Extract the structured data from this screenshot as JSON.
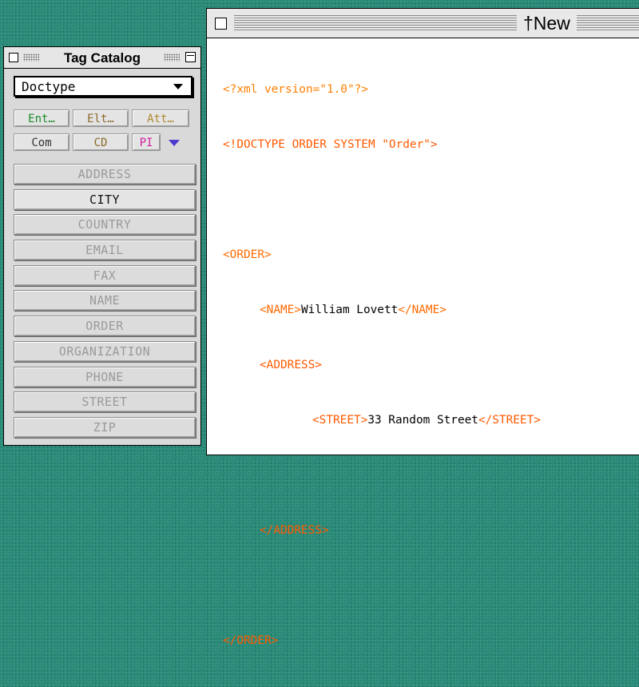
{
  "palette": {
    "title": "Tag Catalog",
    "doctype_value": "Doctype",
    "kind_buttons_row1": [
      {
        "label": "Ent…",
        "color": "#1a8a2a"
      },
      {
        "label": "Elt…",
        "color": "#8a6a2a"
      },
      {
        "label": "Att…",
        "color": "#b08a30"
      }
    ],
    "kind_buttons_row2": [
      {
        "label": "Com",
        "color": "#333333"
      },
      {
        "label": "CD",
        "color": "#8a6a2a"
      },
      {
        "label": "PI",
        "color": "#d01fa0"
      }
    ],
    "tags": [
      {
        "label": "ADDRESS",
        "enabled": false
      },
      {
        "label": "CITY",
        "enabled": true
      },
      {
        "label": "COUNTRY",
        "enabled": false
      },
      {
        "label": "EMAIL",
        "enabled": false
      },
      {
        "label": "FAX",
        "enabled": false
      },
      {
        "label": "NAME",
        "enabled": false
      },
      {
        "label": "ORDER",
        "enabled": false
      },
      {
        "label": "ORGANIZATION",
        "enabled": false
      },
      {
        "label": "PHONE",
        "enabled": false
      },
      {
        "label": "STREET",
        "enabled": false
      },
      {
        "label": "ZIP",
        "enabled": false
      }
    ]
  },
  "editor": {
    "title": "†New",
    "code": {
      "xml_decl": "<?xml version=\"1.0\"?>",
      "doctype_decl": "<!DOCTYPE ORDER SYSTEM \"Order\">",
      "order_open": "<ORDER>",
      "name_open": "<NAME>",
      "name_text": "William Lovett",
      "name_close": "</NAME>",
      "address_open": "<ADDRESS>",
      "street_open": "<STREET>",
      "street_text": "33 Random Street",
      "street_close": "</STREET>",
      "address_close": "</ADDRESS>",
      "order_close": "</ORDER>"
    }
  },
  "colors": {
    "desktop": "#2c8a78",
    "markup": "#ff6a00",
    "dimmed_tag": "#9a9a9a"
  }
}
